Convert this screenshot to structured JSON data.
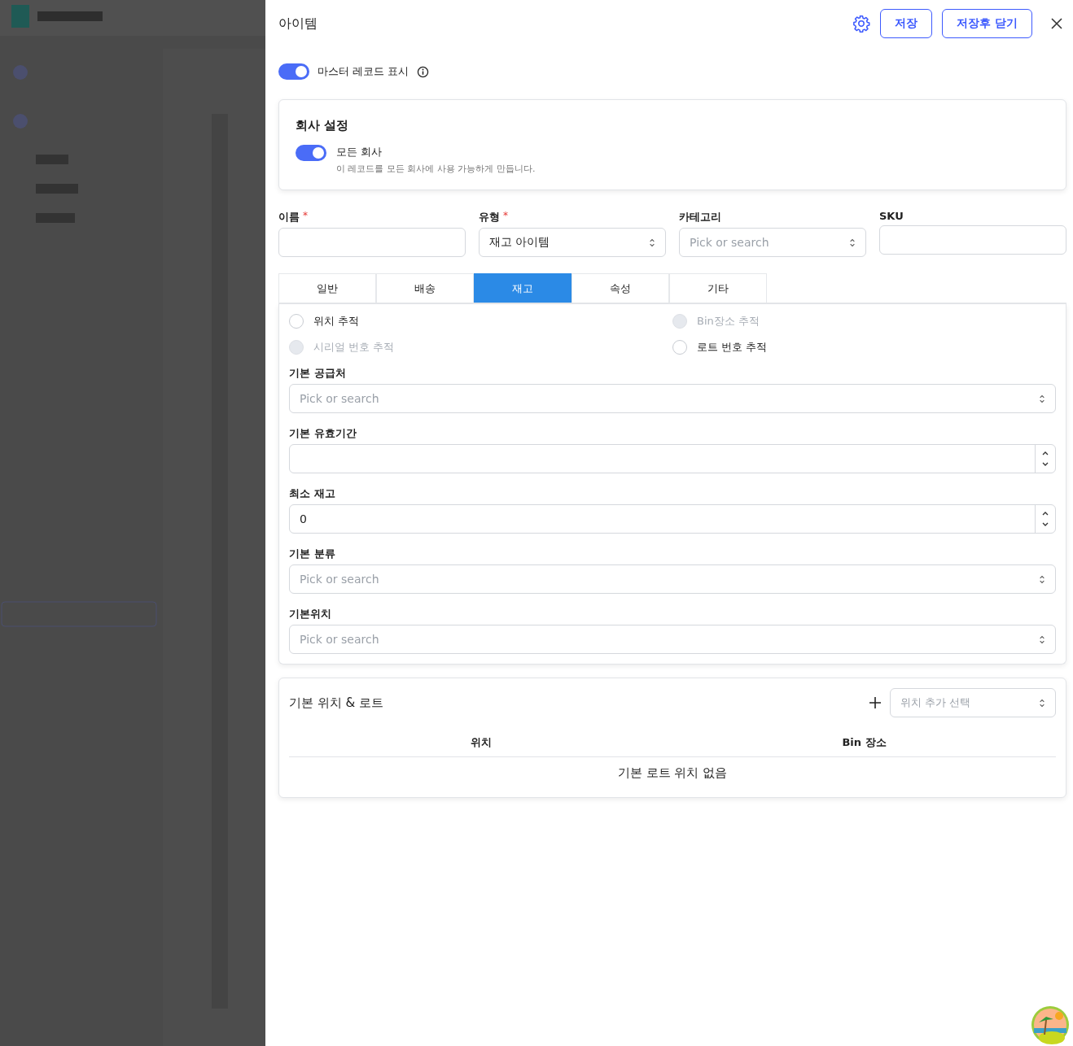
{
  "panel": {
    "title": "아이템",
    "buttons": [
      {
        "label": "저장"
      },
      {
        "label": "저장후 닫기"
      }
    ]
  },
  "master_toggle": {
    "label": "마스터 레코드 표시",
    "on": true
  },
  "company_settings": {
    "title": "회사 설정",
    "toggle": {
      "label": "모든 회사",
      "on": true,
      "description": "이 레코드를 모든 회사에 사용 가능하게 만듭니다."
    }
  },
  "fields": [
    {
      "label": "이름",
      "required_mark": "*",
      "kind": "text"
    },
    {
      "label": "유형",
      "required_mark": "*",
      "kind": "select",
      "value": "재고 아이템"
    },
    {
      "label": "카테고리",
      "kind": "select",
      "placeholder": "Pick or search"
    },
    {
      "label": "SKU",
      "kind": "text"
    }
  ],
  "tabs": [
    {
      "label": "일반",
      "selected": false
    },
    {
      "label": "배송",
      "selected": false
    },
    {
      "label": "재고",
      "selected": true
    },
    {
      "label": "속성",
      "selected": false
    },
    {
      "label": "기타",
      "selected": false
    }
  ],
  "checkboxes": [
    {
      "label": "위치 추적",
      "checked": false,
      "disabled": false
    },
    {
      "label": "Bin장소 추적",
      "checked": false,
      "disabled": true
    },
    {
      "label": "시리얼 번호 추적",
      "checked": false,
      "disabled": true
    },
    {
      "label": "로트 번호 추적",
      "checked": false,
      "disabled": false
    }
  ],
  "inventory_fields": [
    {
      "label": "기본 공급처",
      "kind": "select",
      "placeholder": "Pick or search"
    },
    {
      "label": "기본 유효기간",
      "kind": "number"
    },
    {
      "label": "최소 재고",
      "kind": "number",
      "value": "0"
    },
    {
      "label": "기본 분류",
      "kind": "select",
      "placeholder": "Pick or search"
    },
    {
      "label": "기본위치",
      "kind": "select",
      "placeholder": "Pick or search"
    }
  ],
  "locations": {
    "title": "기본 위치 & 로트",
    "add_placeholder": "위치 추가 선택",
    "columns": [
      "위치",
      "Bin 장소"
    ],
    "empty": "기본 로트 위치 없음"
  }
}
